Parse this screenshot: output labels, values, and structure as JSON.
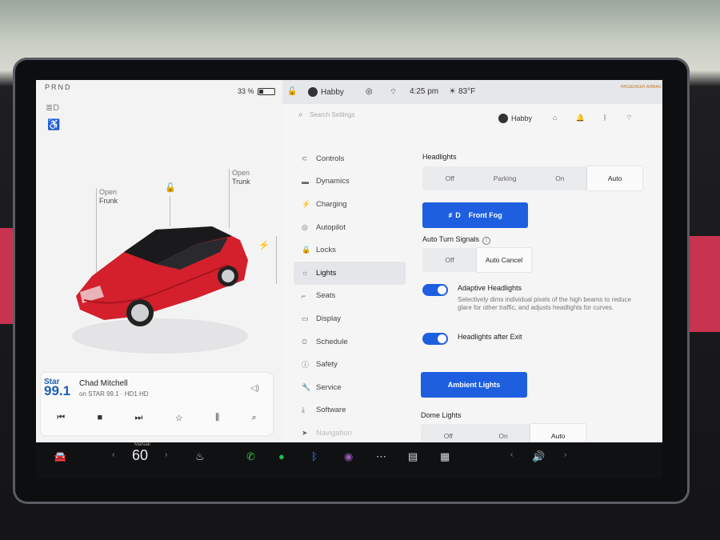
{
  "status": {
    "gear": "PRND",
    "battery": "33 %",
    "battery_level": 0.33,
    "user": "Habby",
    "time": "4:25 pm",
    "temp": "83°F",
    "airbag": "PASSENGER AIRBAG"
  },
  "car": {
    "frunk_label1": "Open",
    "frunk_label2": "Frunk",
    "trunk_label1": "Open",
    "trunk_label2": "Trunk",
    "color": "#d3202c"
  },
  "media": {
    "station_logo_top": "Star",
    "station_logo_num": "99.1",
    "song": "Chad Mitchell",
    "subtitle": "on STAR 99.1 · HD1 HD"
  },
  "settings": {
    "search_placeholder": "Search Settings",
    "user": "Habby",
    "nav": [
      {
        "label": "Controls",
        "icon": "toggle-icon"
      },
      {
        "label": "Dynamics",
        "icon": "car-icon"
      },
      {
        "label": "Charging",
        "icon": "bolt-icon"
      },
      {
        "label": "Autopilot",
        "icon": "steering-icon"
      },
      {
        "label": "Locks",
        "icon": "lock-icon"
      },
      {
        "label": "Lights",
        "icon": "sun-icon",
        "active": true
      },
      {
        "label": "Seats",
        "icon": "seat-icon"
      },
      {
        "label": "Display",
        "icon": "display-icon"
      },
      {
        "label": "Schedule",
        "icon": "clock-icon"
      },
      {
        "label": "Safety",
        "icon": "info-icon"
      },
      {
        "label": "Service",
        "icon": "wrench-icon"
      },
      {
        "label": "Software",
        "icon": "download-icon"
      },
      {
        "label": "Navigation",
        "icon": "nav-icon"
      }
    ],
    "headlights": {
      "title": "Headlights",
      "options": [
        "Off",
        "Parking",
        "On",
        "Auto"
      ],
      "selected": "Auto"
    },
    "front_fog": "Front Fog",
    "auto_turn": {
      "title": "Auto Turn Signals",
      "options": [
        "Off",
        "Auto Cancel"
      ],
      "selected": "Auto Cancel"
    },
    "adaptive": {
      "title": "Adaptive Headlights",
      "desc": "Selectively dims individual pixels of the high beams to reduce glare for other traffic, and adjusts headlights for curves.",
      "on": true
    },
    "after_exit": {
      "title": "Headlights after Exit",
      "on": true
    },
    "ambient": "Ambient Lights",
    "dome": {
      "title": "Dome Lights",
      "options": [
        "Off",
        "On",
        "Auto"
      ],
      "selected": "Auto"
    }
  },
  "taskbar": {
    "speed": "60",
    "mode": "Manual"
  }
}
